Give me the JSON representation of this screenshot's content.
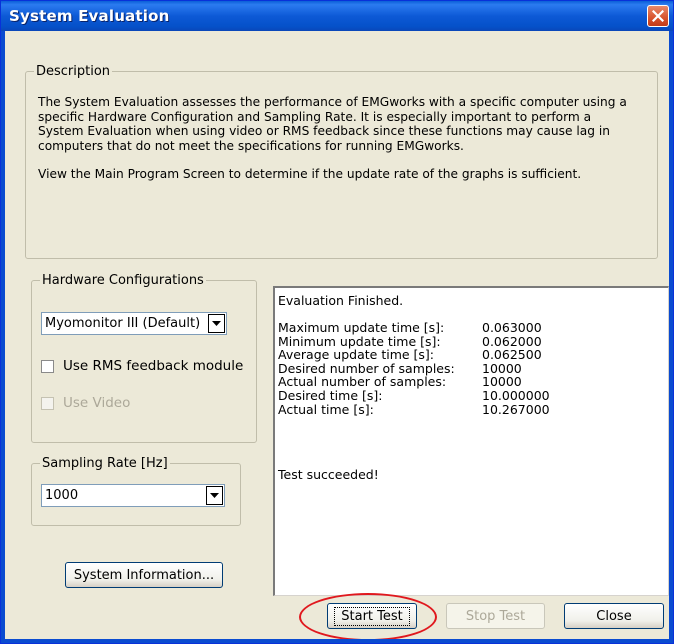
{
  "window": {
    "title": "System Evaluation"
  },
  "description": {
    "legend": "Description",
    "para1": "The System Evaluation assesses the performance of EMGworks with a specific computer using a specific Hardware Configuration and Sampling Rate.  It is especially important to perform a System Evaluation when using video or RMS feedback since these functions may cause lag in computers that do not meet the specifications for running EMGworks.",
    "para2": "View the Main Program Screen to determine if the update rate of the graphs is sufficient."
  },
  "hardware": {
    "legend": "Hardware Configurations",
    "selected": "Myomonitor III (Default)",
    "rms_label": "Use RMS feedback module",
    "rms_checked": false,
    "video_label": "Use Video",
    "video_checked": false,
    "video_enabled": false
  },
  "sampling": {
    "legend": "Sampling Rate [Hz]",
    "selected": "1000"
  },
  "system_info_label": "System Information...",
  "results": {
    "status": "Evaluation Finished.",
    "stats": [
      {
        "label": "Maximum update time [s]:",
        "value": "0.063000"
      },
      {
        "label": "Minimum update time [s]:",
        "value": "0.062000"
      },
      {
        "label": "Average update time [s]:",
        "value": "0.062500"
      },
      {
        "label": "Desired number of samples:",
        "value": "10000"
      },
      {
        "label": "Actual number of samples:",
        "value": "10000"
      },
      {
        "label": "Desired time [s]:",
        "value": "10.000000"
      },
      {
        "label": "Actual time [s]:",
        "value": "10.267000"
      }
    ],
    "outcome": "Test succeeded!"
  },
  "buttons": {
    "start": "Start Test",
    "stop": "Stop Test",
    "close": "Close"
  },
  "colors": {
    "titlebar": "#0A5FD8",
    "dialog_bg": "#ECE9D8",
    "close_button": "#D8532C",
    "highlight_circle": "#E0181E"
  }
}
